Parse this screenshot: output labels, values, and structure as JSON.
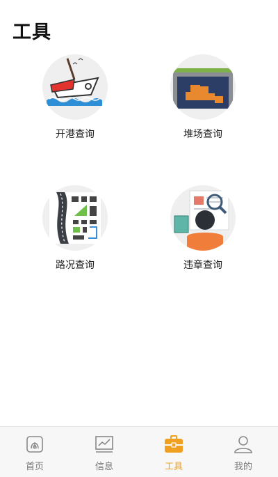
{
  "page": {
    "title": "工具"
  },
  "tools": [
    {
      "label": "开港查询",
      "icon": "ship-icon"
    },
    {
      "label": "堆场查询",
      "icon": "warehouse-icon"
    },
    {
      "label": "路况查询",
      "icon": "road-map-icon"
    },
    {
      "label": "违章查询",
      "icon": "violation-search-icon"
    }
  ],
  "tabbar": {
    "active_color": "#f0a020",
    "items": [
      {
        "label": "首页",
        "icon": "home-icon",
        "active": false
      },
      {
        "label": "信息",
        "icon": "chart-icon",
        "active": false
      },
      {
        "label": "工具",
        "icon": "toolbox-icon",
        "active": true
      },
      {
        "label": "我的",
        "icon": "user-icon",
        "active": false
      }
    ]
  }
}
